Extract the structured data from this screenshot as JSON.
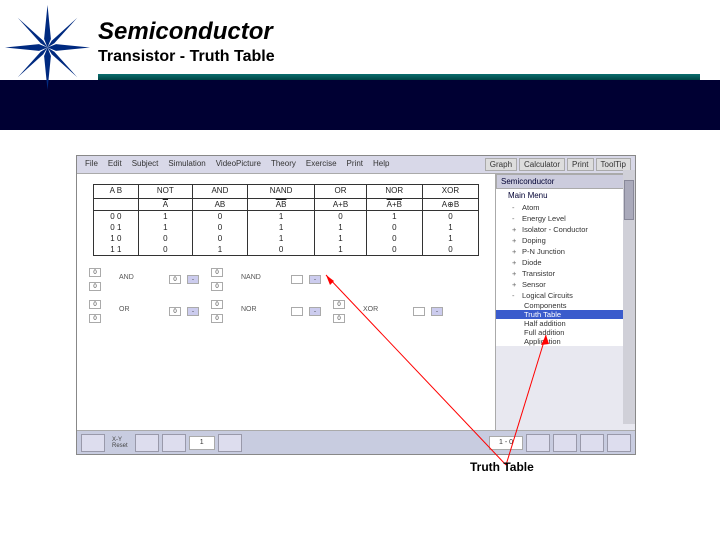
{
  "slide": {
    "title": "Semiconductor",
    "subtitle": "Transistor   -   Truth Table"
  },
  "menubar": {
    "items": [
      "File",
      "Edit",
      "Subject",
      "Simulation",
      "VideoPicture",
      "Theory",
      "Exercise",
      "Print",
      "Help"
    ],
    "tools": [
      "Graph",
      "Calculator",
      "Print",
      "ToolTip"
    ]
  },
  "truth": {
    "headers": [
      "A  B",
      "NOT",
      "AND",
      "NAND",
      "OR",
      "NOR",
      "XOR"
    ],
    "expr": [
      "",
      "A",
      "AB",
      "AB",
      "A+B",
      "A+B",
      "A⊕B"
    ],
    "expr_ovl": [
      false,
      true,
      false,
      true,
      false,
      true,
      false
    ],
    "rows": [
      [
        "0  0",
        "1",
        "0",
        "1",
        "0",
        "1",
        "0"
      ],
      [
        "0  1",
        "1",
        "0",
        "1",
        "1",
        "0",
        "1"
      ],
      [
        "1  0",
        "0",
        "0",
        "1",
        "1",
        "0",
        "1"
      ],
      [
        "1  1",
        "0",
        "1",
        "0",
        "1",
        "0",
        "0"
      ]
    ]
  },
  "gates": [
    {
      "name": "AND",
      "in1": "0",
      "in2": "0",
      "out": "0",
      "ctl": "-"
    },
    {
      "name": "NAND",
      "in1": "0",
      "in2": "0",
      "out": "",
      "ctl": "-"
    },
    {
      "name": "",
      "in1": "",
      "in2": "",
      "out": "",
      "ctl": ""
    },
    {
      "name": "OR",
      "in1": "0",
      "in2": "0",
      "out": "0",
      "ctl": "-"
    },
    {
      "name": "NOR",
      "in1": "0",
      "in2": "0",
      "out": "",
      "ctl": "-"
    },
    {
      "name": "XOR",
      "in1": "0",
      "in2": "0",
      "out": "",
      "ctl": "-"
    }
  ],
  "sidebar": {
    "header": "Semiconductor",
    "mainmenu": "Main Menu",
    "items": [
      {
        "plus": "-",
        "label": "Atom"
      },
      {
        "plus": "-",
        "label": "Energy Level"
      },
      {
        "plus": "+",
        "label": "Isolator - Conductor"
      },
      {
        "plus": "+",
        "label": "Doping"
      },
      {
        "plus": "+",
        "label": "P-N Junction"
      },
      {
        "plus": "+",
        "label": "Diode"
      },
      {
        "plus": "+",
        "label": "Transistor"
      },
      {
        "plus": "+",
        "label": "Sensor"
      },
      {
        "plus": "-",
        "label": "Logical Circuits"
      }
    ],
    "subs": [
      {
        "label": "Components",
        "sel": false
      },
      {
        "label": "Truth Table",
        "sel": true
      },
      {
        "label": "Half addition",
        "sel": false
      },
      {
        "label": "Full addition",
        "sel": false
      },
      {
        "label": "Application",
        "sel": false
      }
    ]
  },
  "status": {
    "xy": "X-Y",
    "reset": "Reset",
    "val1": "1",
    "val2": "1 - 0"
  },
  "caption": "Truth Table"
}
